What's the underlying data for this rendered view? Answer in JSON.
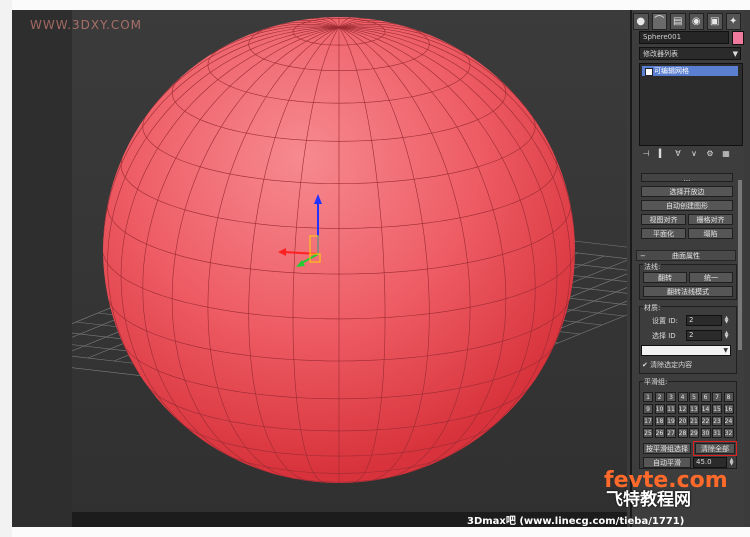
{
  "watermark": {
    "text": "WWW.3DXY.COM"
  },
  "panel": {
    "object_name": "Sphere001",
    "object_color": "#f07a9e",
    "modifier_list": "修改器列表",
    "stack": [
      "可编辑网格"
    ],
    "tabs": [
      "create-icon",
      "modify-icon",
      "hierarchy-icon",
      "motion-icon",
      "display-icon",
      "utilities-icon"
    ],
    "buttons": {
      "select_open": "选择开放边",
      "auto_smooth_make": "自动创建图形",
      "view_align": "视图对齐",
      "grid_align": "栅格对齐",
      "planarize": "平面化",
      "collapse": "塌陷"
    },
    "surface": {
      "title": "曲面属性",
      "normals_label": "法线:",
      "flip": "翻转",
      "unify": "统一",
      "flip_mode": "翻转法线模式",
      "material_label": "材质:",
      "set_id_label": "设置 ID:",
      "set_id_value": "2",
      "select_id_label": "选择 ID",
      "select_id_value": "2",
      "clear_selection": "清除选定内容"
    },
    "smoothing": {
      "label": "平滑组:",
      "numbers": [
        "1",
        "2",
        "3",
        "4",
        "5",
        "6",
        "7",
        "8",
        "9",
        "10",
        "11",
        "12",
        "13",
        "14",
        "15",
        "16",
        "17",
        "18",
        "19",
        "20",
        "21",
        "22",
        "23",
        "24",
        "25",
        "26",
        "27",
        "28",
        "29",
        "30",
        "31",
        "32"
      ],
      "select_by": "按平滑组选择",
      "clear_all": "清除全部",
      "auto_smooth": "自动平滑",
      "threshold": "45.0"
    }
  },
  "footer": {
    "text": "3Dmax吧 (www.linecg.com/tieba/1771)"
  },
  "brand": {
    "line1": "fevte.com",
    "line2": "飞特教程网"
  },
  "colors": {
    "sphere": "#ef4d57",
    "highlight": "#e02020",
    "selected": "#5b7fd0"
  }
}
